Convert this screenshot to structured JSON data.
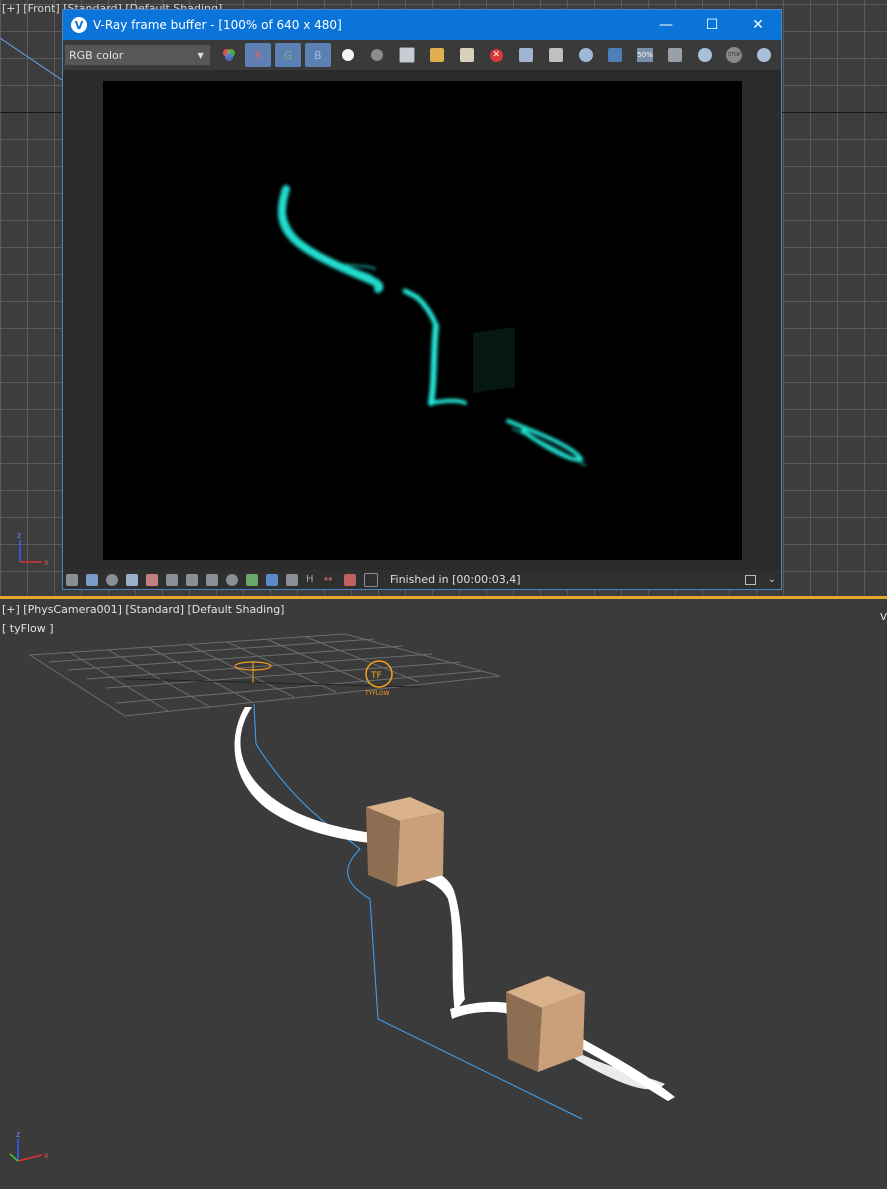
{
  "top_viewport": {
    "label": "[+] [Front] [Standard] [Default Shading]"
  },
  "vfb": {
    "title": "V-Ray frame buffer - [100% of 640 x 480]",
    "logo_letter": "V",
    "channel": "RGB color",
    "btn_r": "R",
    "btn_g": "G",
    "btn_b": "B",
    "zoom_badge": "50%",
    "stop_badge": "STOP",
    "status": "Finished in [00:00:03,4]"
  },
  "bottom_viewport": {
    "label": "[+] [PhysCamera001] [Standard] [Default Shading]",
    "sublabel": "[ tyFlow ]",
    "corner": "V",
    "tyflow_icon_text": "TYFLOW"
  },
  "axes": {
    "x": "x",
    "z": "z"
  },
  "colors": {
    "accent": "#0b74d8",
    "viewport_border": "#e3a92a",
    "render_glow": "#21e6d6",
    "box": "#c9a07a",
    "spline": "#3aa6ff",
    "tyflow_orange": "#f5a01f"
  }
}
